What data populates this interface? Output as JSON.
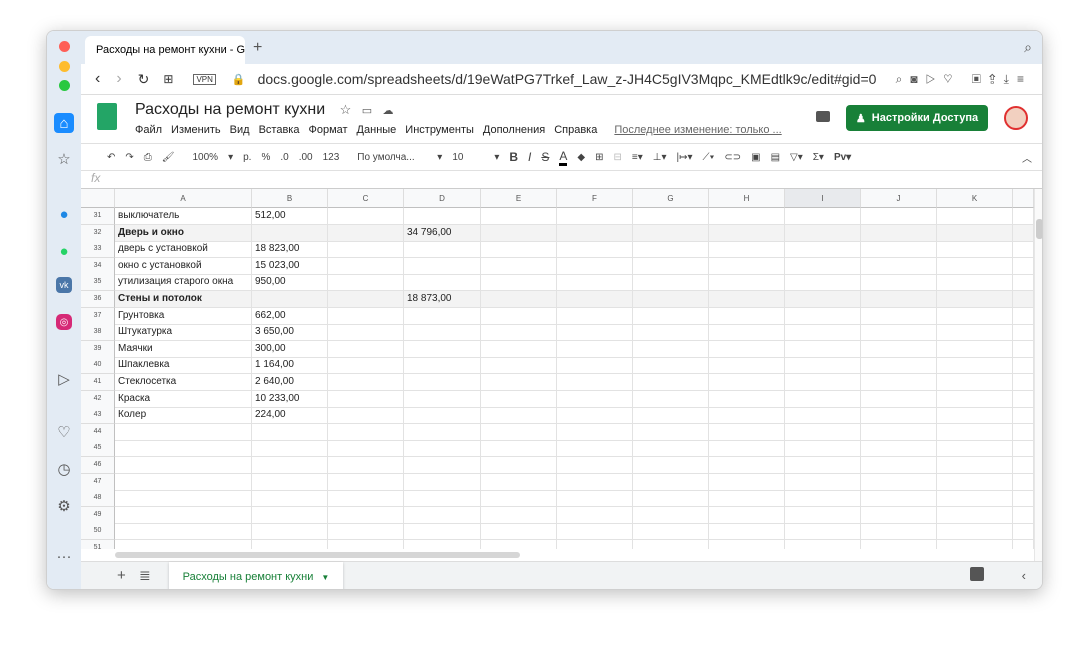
{
  "browser": {
    "tab_title": "Расходы на ремонт кухни - Go",
    "url": "docs.google.com/spreadsheets/d/19eWatPG7Trkef_Law_z-JH4C5gIV3Mqpc_KMEdtlk9c/edit#gid=0",
    "vpn": "VPN"
  },
  "doc": {
    "title": "Расходы на ремонт кухни",
    "last_edit": "Последнее изменение: только ...",
    "share_label": "Настройки Доступа",
    "menu": [
      "Файл",
      "Изменить",
      "Вид",
      "Вставка",
      "Формат",
      "Данные",
      "Инструменты",
      "Дополнения",
      "Справка"
    ]
  },
  "toolbar": {
    "zoom": "100%",
    "currency": "р.",
    "percent": "%",
    "dec_less": ".0",
    "dec_more": ".00",
    "format": "123",
    "font": "По умолча...",
    "size": "10"
  },
  "formula_bar": {
    "fx": "fx",
    "value": ""
  },
  "columns": [
    "A",
    "B",
    "C",
    "D",
    "E",
    "F",
    "G",
    "H",
    "I",
    "J",
    "K"
  ],
  "rows": [
    {
      "n": "31",
      "a": "выключатель",
      "b": "512,00",
      "d": ""
    },
    {
      "n": "32",
      "a": "Дверь и окно",
      "b": "",
      "d": "34 796,00",
      "bold": true
    },
    {
      "n": "33",
      "a": "дверь с установкой",
      "b": "18 823,00",
      "d": ""
    },
    {
      "n": "34",
      "a": "окно с установкой",
      "b": "15 023,00",
      "d": ""
    },
    {
      "n": "35",
      "a": "утилизация старого окна",
      "b": "950,00",
      "d": ""
    },
    {
      "n": "36",
      "a": "Стены и потолок",
      "b": "",
      "d": "18 873,00",
      "bold": true
    },
    {
      "n": "37",
      "a": "Грунтовка",
      "b": "662,00",
      "d": ""
    },
    {
      "n": "38",
      "a": "Штукатурка",
      "b": "3 650,00",
      "d": ""
    },
    {
      "n": "39",
      "a": "Маячки",
      "b": "300,00",
      "d": ""
    },
    {
      "n": "40",
      "a": "Шпаклевка",
      "b": "1 164,00",
      "d": ""
    },
    {
      "n": "41",
      "a": "Стеклосетка",
      "b": "2 640,00",
      "d": ""
    },
    {
      "n": "42",
      "a": "Краска",
      "b": "10 233,00",
      "d": ""
    },
    {
      "n": "43",
      "a": "Колер",
      "b": "224,00",
      "d": ""
    },
    {
      "n": "44"
    },
    {
      "n": "45"
    },
    {
      "n": "46"
    },
    {
      "n": "47"
    },
    {
      "n": "48"
    },
    {
      "n": "49"
    },
    {
      "n": "50"
    },
    {
      "n": "51"
    }
  ],
  "sheet_tab": "Расходы на ремонт кухни",
  "colors": {
    "green": "#188038",
    "sidebar": "#e3ebf4",
    "header_bold_row": "#f3f3f3"
  }
}
